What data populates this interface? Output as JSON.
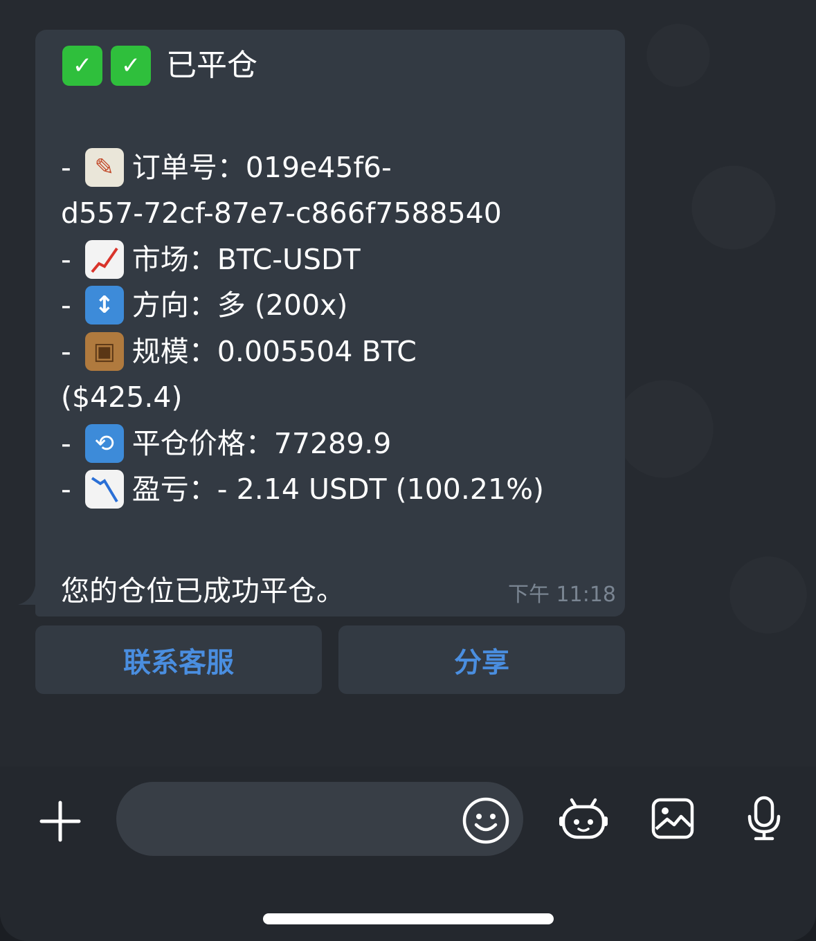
{
  "message": {
    "title": "已平仓",
    "title_icons": [
      "check-mark-icon",
      "check-mark-icon"
    ],
    "order_label": "订单号：",
    "order_value_1": "019e45f6-",
    "order_value_2": "d557-72cf-87e7-c866f7588540",
    "market_label": "市场：",
    "market_value": "BTC-USDT",
    "direction_label": "方向：",
    "direction_value": "多 (200x)",
    "size_label": "规模：",
    "size_value": "0.005504 BTC",
    "size_value_usd": "($425.4)",
    "close_price_label": "平仓价格：",
    "close_price_value": "77289.9",
    "pnl_label": "盈亏：",
    "pnl_value": "- 2.14 USDT (100.21%)",
    "footer": "您的仓位已成功平仓。",
    "dash": "-",
    "timestamp": "下午 11:18"
  },
  "buttons": {
    "contact_label": "联系客服",
    "share_label": "分享"
  },
  "colors": {
    "bubble": "#333a43",
    "button_text": "#4a8ee0",
    "timestamp": "#7a8592",
    "check_green": "#2fbf3c"
  }
}
